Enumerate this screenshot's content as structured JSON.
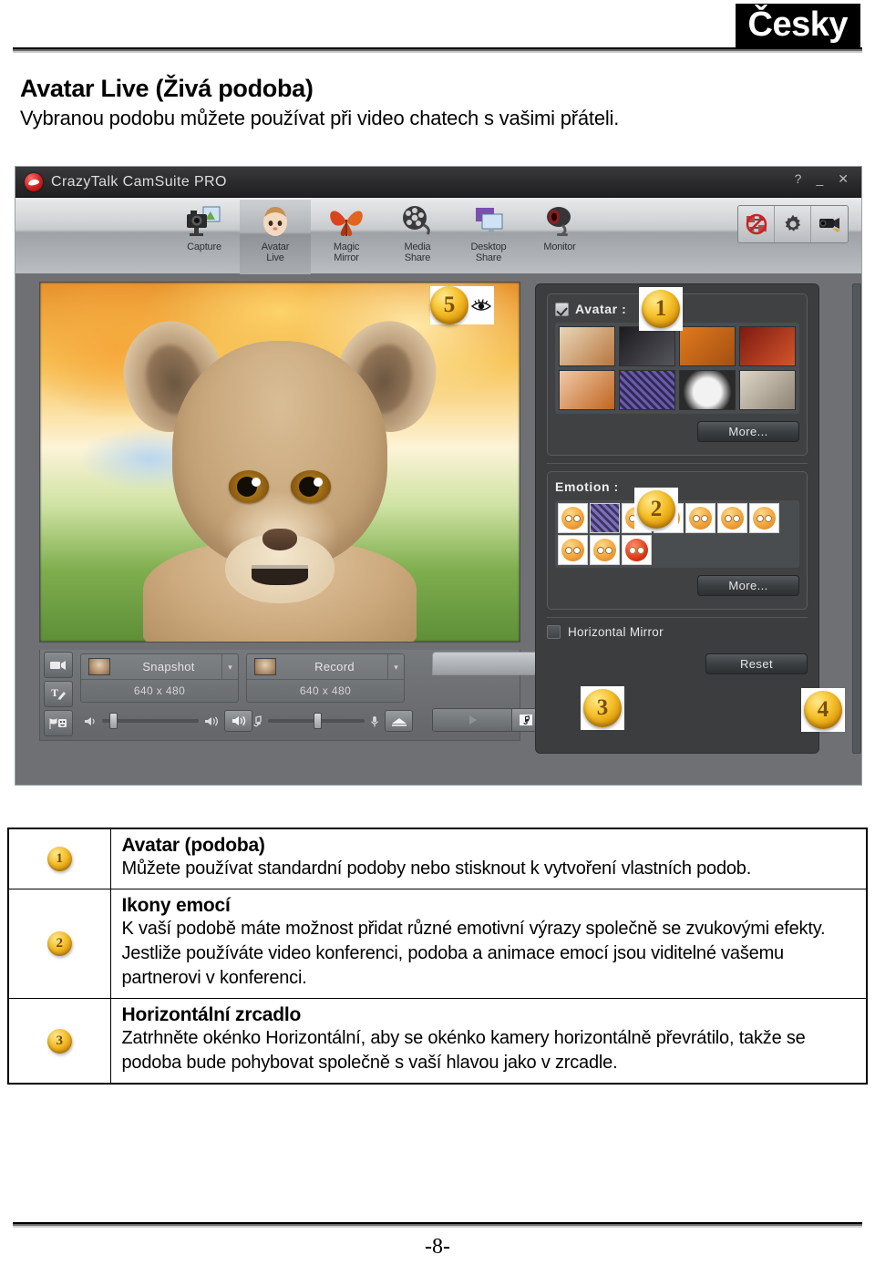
{
  "document": {
    "language_badge": "Česky",
    "title": "Avatar Live (Živá podoba)",
    "subtitle": "Vybranou podobu můžete používat při video chatech s vašimi přáteli.",
    "page_number": "-8-"
  },
  "app": {
    "window_title": "CrazyTalk CamSuite PRO",
    "window_buttons": {
      "help": "?",
      "minimize": "_",
      "close": "✕"
    },
    "modules": [
      {
        "label_line1": "Capture",
        "label_line2": "",
        "icon": "camera-photo-icon",
        "active": false
      },
      {
        "label_line1": "Avatar",
        "label_line2": "Live",
        "icon": "baby-face-icon",
        "active": true
      },
      {
        "label_line1": "Magic",
        "label_line2": "Mirror",
        "icon": "butterfly-mask-icon",
        "active": false
      },
      {
        "label_line1": "Media",
        "label_line2": "Share",
        "icon": "film-reel-icon",
        "active": false
      },
      {
        "label_line1": "Desktop",
        "label_line2": "Share",
        "icon": "monitor-share-icon",
        "active": false
      },
      {
        "label_line1": "Monitor",
        "label_line2": "",
        "icon": "webcam-icon",
        "active": false
      }
    ],
    "toolbar_right": [
      {
        "icon": "disable-share-icon"
      },
      {
        "icon": "gear-icon"
      },
      {
        "icon": "camera-setup-icon"
      }
    ],
    "preview": {
      "content": "lion-cub-avatar",
      "overlay_badge": "5",
      "overlay_icon": "eye-icon"
    },
    "side_tools": [
      {
        "icon": "video-clip-icon"
      },
      {
        "icon": "text-tool-icon"
      },
      {
        "icon": "sticker-tool-icon"
      }
    ],
    "capture": {
      "snapshot": {
        "label": "Snapshot",
        "resolution": "640 x 480",
        "caret": "▾"
      },
      "record": {
        "label": "Record",
        "resolution": "640 x 480",
        "caret": "▾"
      }
    },
    "audio": {
      "speaker_icon_left": "speaker-low-icon",
      "speaker_icon_right": "speaker-high-icon",
      "speaker_mute_button": "speaker-button-icon",
      "music_icon_left": "music-note-icon",
      "mic_icon_right": "microphone-icon",
      "voice_button": "voice-changer-icon"
    },
    "player": {
      "play_icon": "play-icon",
      "browse_icon": "music-file-icon"
    },
    "panel": {
      "avatar_group": {
        "label": "Avatar :",
        "checkbox_checked": true,
        "thumbnails": [
          {
            "name": "boy-puppet-avatar",
            "c1": "#e8d7b8",
            "c2": "#b9753f"
          },
          {
            "name": "dark-skull-avatar",
            "c1": "#1b1b1f",
            "c2": "#55555c"
          },
          {
            "name": "ogre-avatar",
            "c1": "#e07b1e",
            "c2": "#a44f12"
          },
          {
            "name": "pirate-avatar",
            "c1": "#7d1a12",
            "c2": "#d4562a"
          },
          {
            "name": "doll-girl-avatar",
            "c1": "#f0c9a8",
            "c2": "#c0651f"
          },
          {
            "name": "purple-noise-avatar",
            "c1": "#6a5aa8",
            "c2": "#2e2a55"
          },
          {
            "name": "panda-avatar",
            "c1": "#f2f2f2",
            "c2": "#2a2a2a"
          },
          {
            "name": "stone-statue-avatar",
            "c1": "#ddd6c6",
            "c2": "#8d8375"
          }
        ],
        "more_label": "More..."
      },
      "emotion_group": {
        "label": "Emotion :",
        "count": 10,
        "icons": [
          "angry-wink-emotion",
          "masked-emotion",
          "sleepy-emotion",
          "tongue-out-emotion",
          "whistle-emotion",
          "mad-emotion",
          "crying-emotion",
          "happy-emotion",
          "laugh-emotion",
          "devil-emotion"
        ],
        "more_label": "More..."
      },
      "mirror": {
        "label": "Horizontal Mirror",
        "checked": false
      },
      "reset_label": "Reset"
    },
    "callouts": [
      {
        "number": "1",
        "target": "avatar-group"
      },
      {
        "number": "2",
        "target": "emotion-group"
      },
      {
        "number": "3",
        "target": "horizontal-mirror"
      },
      {
        "number": "4",
        "target": "reset-button"
      },
      {
        "number": "5",
        "target": "preview-eye-toggle"
      }
    ]
  },
  "description_table": {
    "rows": [
      {
        "number": "1",
        "title": "Avatar (podoba)",
        "body": "Můžete používat standardní podoby nebo stisknout k vytvoření vlastních podob."
      },
      {
        "number": "2",
        "title": "Ikony emocí",
        "body": "K vaší podobě máte možnost přidat různé emotivní výrazy společně se zvukovými efekty. Jestliže používáte video konferenci, podoba a animace emocí jsou viditelné vašemu partnerovi v konferenci."
      },
      {
        "number": "3",
        "title": "Horizontální zrcadlo",
        "body": "Zatrhněte okénko Horizontální, aby se okénko kamery horizontálně převrátilo, takže se podoba bude pohybovat společně s vaší hlavou jako v zrcadle."
      }
    ]
  }
}
